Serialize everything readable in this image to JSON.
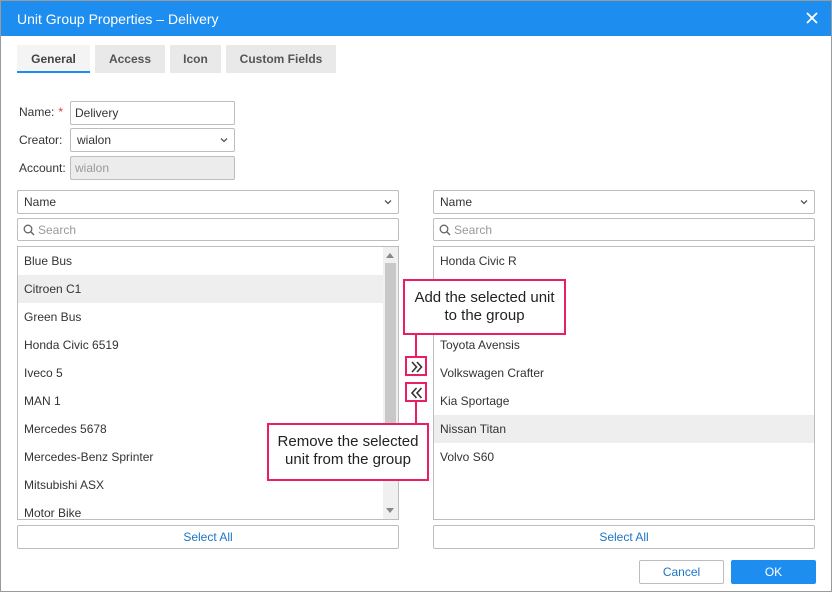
{
  "dialog": {
    "title": "Unit Group Properties – Delivery",
    "tabs": [
      "General",
      "Access",
      "Icon",
      "Custom Fields"
    ]
  },
  "form": {
    "name_label": "Name:",
    "required_mark": "*",
    "name_value": "Delivery",
    "creator_label": "Creator:",
    "creator_value": "wialon",
    "account_label": "Account:",
    "account_value": "wialon"
  },
  "left_panel": {
    "sort_value": "Name",
    "search_placeholder": "Search",
    "items": [
      "Blue Bus",
      "Citroen C1",
      "Green Bus",
      "Honda Civic 6519",
      "Iveco 5",
      "MAN 1",
      "Mercedes 5678",
      "Mercedes-Benz Sprinter",
      "Mitsubishi ASX",
      "Motor Bike"
    ],
    "selected_item": "Citroen C1",
    "select_all_label": "Select All"
  },
  "right_panel": {
    "sort_value": "Name",
    "search_placeholder": "Search",
    "items": [
      "Honda Civic R",
      "",
      "",
      "Toyota Avensis",
      "Volkswagen Crafter",
      "Kia Sportage",
      "Nissan Titan",
      "Volvo S60"
    ],
    "selected_item": "Nissan Titan",
    "select_all_label": "Select All"
  },
  "callouts": {
    "add_line1": "Add the selected unit",
    "add_line2": "to the group",
    "remove_line1": "Remove the selected",
    "remove_line2": "unit from the group"
  },
  "footer": {
    "cancel_label": "Cancel",
    "ok_label": "OK"
  },
  "colors": {
    "titlebar": "#1d8ef0",
    "accent": "#1d8ef0",
    "annotation": "#e91e63",
    "link_text": "#1c74c4"
  },
  "icons": {
    "close": "close-icon",
    "dropdown": "chevron-down-icon",
    "search": "search-icon",
    "add": "double-chevron-right-icon",
    "remove": "double-chevron-left-icon"
  }
}
